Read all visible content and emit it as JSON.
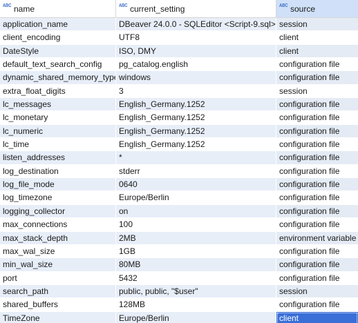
{
  "columns": [
    {
      "label": "name",
      "icon": "abc-type-icon"
    },
    {
      "label": "current_setting",
      "icon": "abc-type-icon"
    },
    {
      "label": "source",
      "icon": "abc-type-icon"
    }
  ],
  "icon_text": "ABC",
  "rows": [
    [
      "application_name",
      "DBeaver 24.0.0 - SQLEditor <Script-9.sql>",
      "session"
    ],
    [
      "client_encoding",
      "UTF8",
      "client"
    ],
    [
      "DateStyle",
      "ISO, DMY",
      "client"
    ],
    [
      "default_text_search_config",
      "pg_catalog.english",
      "configuration file"
    ],
    [
      "dynamic_shared_memory_type",
      "windows",
      "configuration file"
    ],
    [
      "extra_float_digits",
      "3",
      "session"
    ],
    [
      "lc_messages",
      "English_Germany.1252",
      "configuration file"
    ],
    [
      "lc_monetary",
      "English_Germany.1252",
      "configuration file"
    ],
    [
      "lc_numeric",
      "English_Germany.1252",
      "configuration file"
    ],
    [
      "lc_time",
      "English_Germany.1252",
      "configuration file"
    ],
    [
      "listen_addresses",
      "*",
      "configuration file"
    ],
    [
      "log_destination",
      "stderr",
      "configuration file"
    ],
    [
      "log_file_mode",
      "0640",
      "configuration file"
    ],
    [
      "log_timezone",
      "Europe/Berlin",
      "configuration file"
    ],
    [
      "logging_collector",
      "on",
      "configuration file"
    ],
    [
      "max_connections",
      "100",
      "configuration file"
    ],
    [
      "max_stack_depth",
      "2MB",
      "environment variable"
    ],
    [
      "max_wal_size",
      "1GB",
      "configuration file"
    ],
    [
      "min_wal_size",
      "80MB",
      "configuration file"
    ],
    [
      "port",
      "5432",
      "configuration file"
    ],
    [
      "search_path",
      "public, public, \"$user\"",
      "session"
    ],
    [
      "shared_buffers",
      "128MB",
      "configuration file"
    ],
    [
      "TimeZone",
      "Europe/Berlin",
      "client"
    ]
  ],
  "selected_row": 22,
  "colors": {
    "selection": "#3a6fd8",
    "header_source_bg": "#cfe0f8",
    "row_alt": "#e7eef8",
    "icon": "#3a6ec9"
  }
}
